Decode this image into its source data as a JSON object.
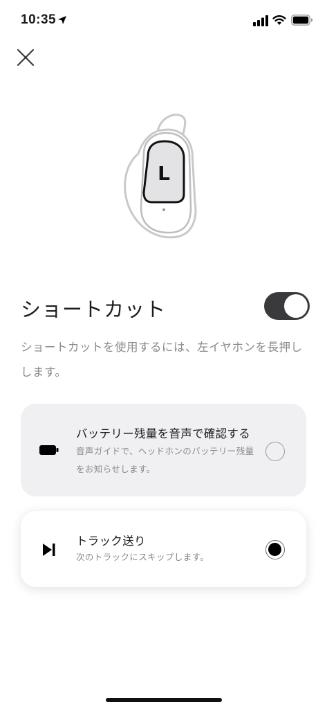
{
  "status_bar": {
    "time": "10:35"
  },
  "shortcut": {
    "title": "ショートカット",
    "enabled": true,
    "description": "ショートカットを使用するには、左イヤホンを長押しします。"
  },
  "earbud": {
    "side_label": "L"
  },
  "options": [
    {
      "title": "バッテリー残量を音声で確認する",
      "subtitle": "音声ガイドで、ヘッドホンのバッテリー残量をお知らせします。",
      "icon": "battery-icon",
      "selected": false
    },
    {
      "title": "トラック送り",
      "subtitle": "次のトラックにスキップします。",
      "icon": "skip-next-icon",
      "selected": true
    }
  ]
}
